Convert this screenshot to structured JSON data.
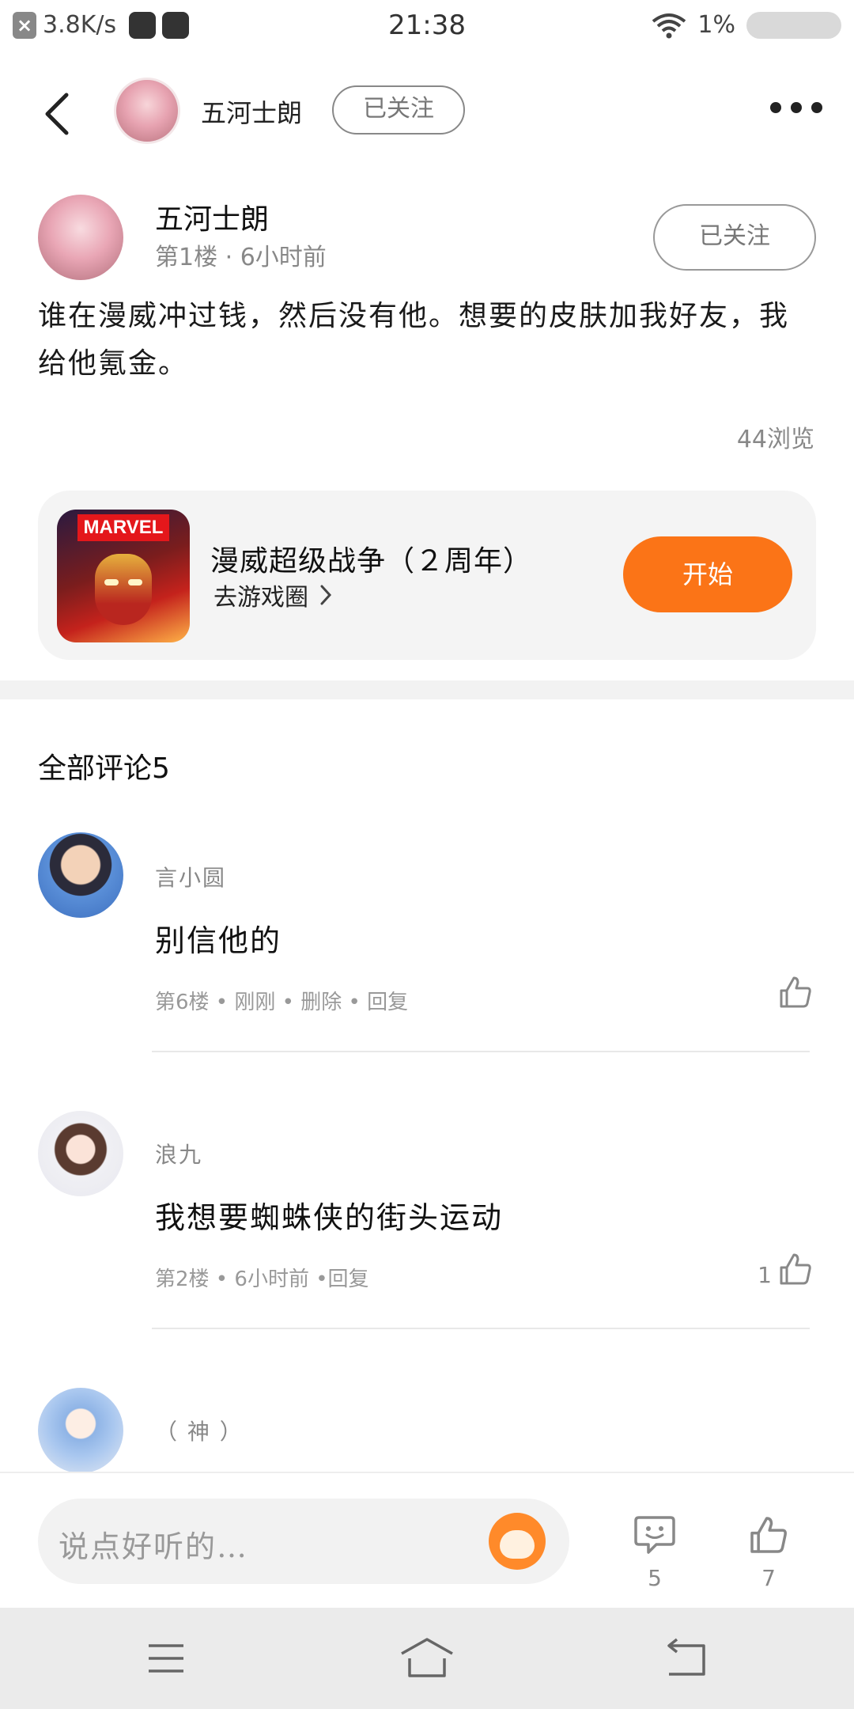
{
  "status_bar": {
    "net_speed": "3.8K/s",
    "time": "21:38",
    "battery_percent": "1%",
    "icons": [
      "close-notification-icon",
      "app-icon",
      "app-icon",
      "wifi-icon",
      "battery-icon"
    ]
  },
  "header": {
    "author_name": "五河士朗",
    "follow_label": "已关注",
    "icons": [
      "back-arrow-icon",
      "more-dots-icon"
    ]
  },
  "post": {
    "author_name": "五河士朗",
    "meta": "第1楼 · 6小时前",
    "follow_label": "已关注",
    "content": "谁在漫威冲过钱，然后没有他。想要的皮肤加我好友，我给他氪金。",
    "views": "44浏览"
  },
  "game_card": {
    "icon_text": "MARVEL",
    "title": "漫威超级战争（２周年）",
    "circle_label": "去游戏圈",
    "start_label": "开始"
  },
  "comments": {
    "title": "全部评论5",
    "items": [
      {
        "name": "言小圆",
        "text": "别信他的",
        "meta": "第6楼 • 刚刚 • 删除 • 回复",
        "likes": ""
      },
      {
        "name": "浪九",
        "text": "我想要蜘蛛侠的街头运动",
        "meta": "第2楼 • 6小时前 •回复",
        "likes": "1"
      },
      {
        "name": "（ 神 ）",
        "text": "",
        "meta": "",
        "likes": ""
      }
    ]
  },
  "bottom_bar": {
    "placeholder": "说点好听的…",
    "comment_count": "5",
    "like_count": "7"
  },
  "colors": {
    "accent": "#fb7417",
    "muted_text": "#888888",
    "card_bg": "#f4f4f4"
  }
}
